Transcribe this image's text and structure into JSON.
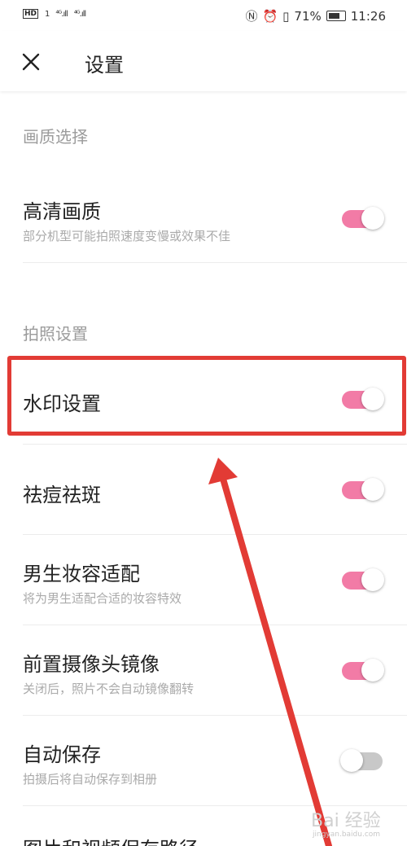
{
  "status_bar": {
    "hd": "HD",
    "sim1": "1",
    "sig1": "⁴ᴳ.ıll",
    "sig2": "⁴ᴳ.ıll",
    "battery_pct": "71%",
    "time": "11:26"
  },
  "header": {
    "title": "设置"
  },
  "sections": {
    "quality": "画质选择",
    "photo": "拍照设置"
  },
  "settings": [
    {
      "title": "高清画质",
      "subtitle": "部分机型可能拍照速度变慢或效果不佳",
      "enabled": true
    },
    {
      "title": "水印设置",
      "subtitle": "",
      "enabled": true
    },
    {
      "title": "祛痘祛斑",
      "subtitle": "",
      "enabled": true
    },
    {
      "title": "男生妆容适配",
      "subtitle": "将为男生适配合适的妆容特效",
      "enabled": true
    },
    {
      "title": "前置摄像头镜像",
      "subtitle": "关闭后，照片不会自动镜像翻转",
      "enabled": true
    },
    {
      "title": "自动保存",
      "subtitle": "拍摄后将自动保存到相册",
      "enabled": false
    },
    {
      "title": "图片和视频保存路径",
      "subtitle": "",
      "enabled": null
    }
  ],
  "watermark": {
    "brand": "Bai 经验",
    "url": "jingyan.baidu.com"
  },
  "colors": {
    "toggle_on": "#f27ba6",
    "toggle_off": "#c8c8c8",
    "annotation_red": "#e23b35"
  }
}
